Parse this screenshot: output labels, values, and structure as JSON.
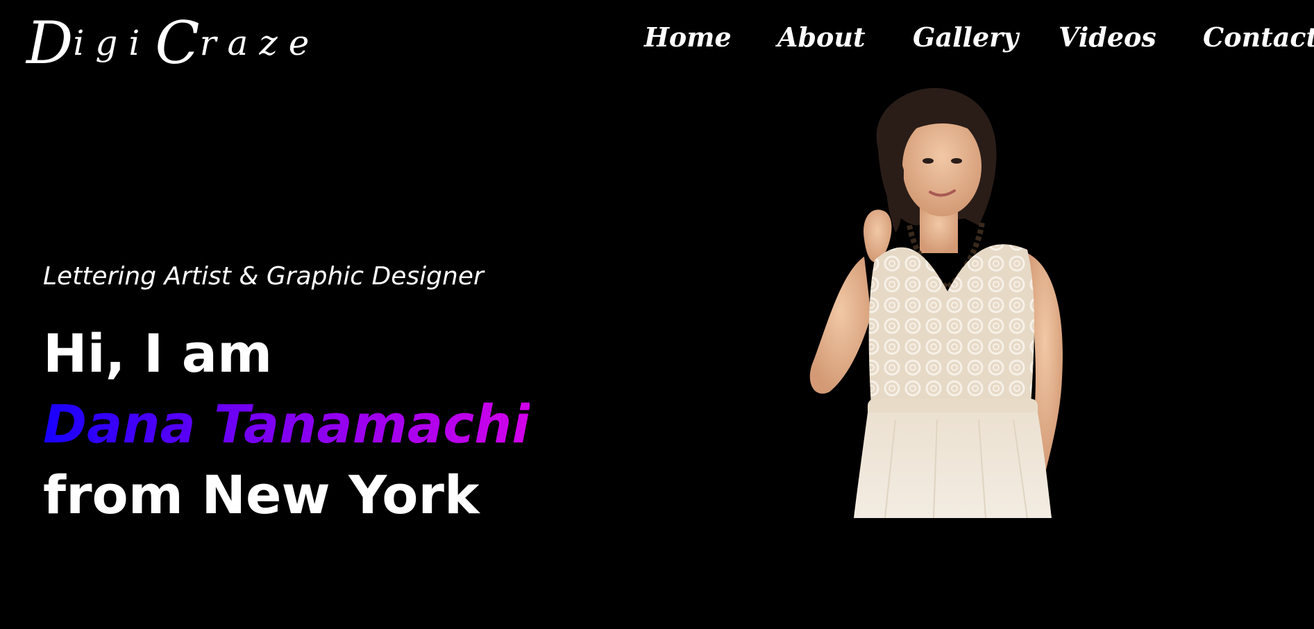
{
  "brand": {
    "logo_d": "D",
    "logo_igi": "igi",
    "logo_c": "C",
    "logo_raze": "raze"
  },
  "nav": {
    "items": [
      {
        "label": "Home"
      },
      {
        "label": "About"
      },
      {
        "label": "Gallery"
      },
      {
        "label": "Videos"
      },
      {
        "label": "Contact"
      }
    ]
  },
  "hero": {
    "subtitle": "Lettering Artist & Graphic Designer",
    "greeting": "Hi, I am",
    "name": "Dana Tanamachi",
    "location": "from New York",
    "name_gradient": [
      "#1800ff",
      "#d200ea"
    ]
  },
  "colors": {
    "background": "#000000",
    "text": "#ffffff"
  }
}
